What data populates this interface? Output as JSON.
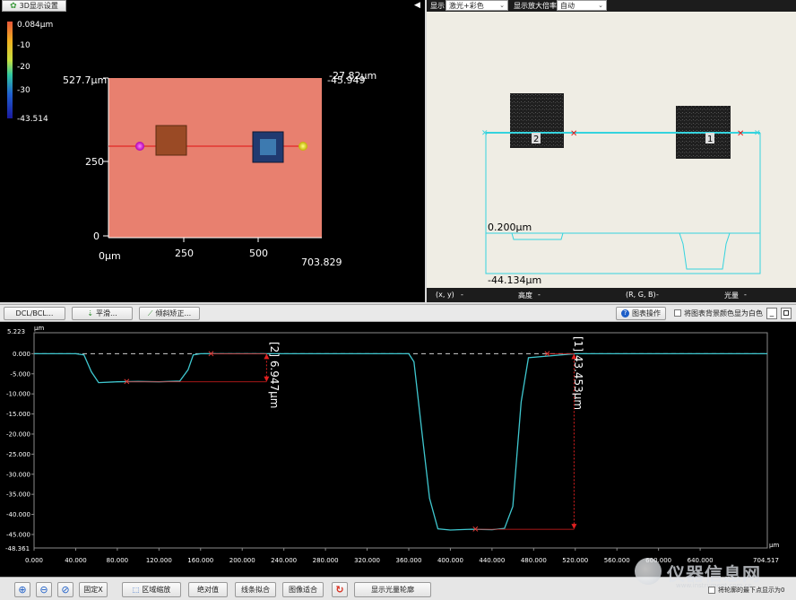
{
  "left_panel": {
    "tab_label": "3D显示设置",
    "colorbar_ticks": [
      "0.084µm",
      "-10",
      "-20",
      "-30",
      "-43.514"
    ],
    "y_top_label": "527.7µm",
    "right_label": "-27.82µm",
    "overlap_label": "-45.949",
    "y_tick_250": "250",
    "y_tick_0": "0",
    "x_ticks": [
      "0µm",
      "250",
      "500"
    ],
    "x_end_label": "703.829"
  },
  "right_panel": {
    "display_label": "显示",
    "display_mode": "激光+彩色",
    "zoom_label": "显示放大倍率",
    "zoom_value": "自动",
    "marker_2": "2",
    "marker_1": "1",
    "profile_top_value": "0.200µm",
    "profile_bottom_value": "-44.134µm",
    "status": {
      "xy": "(x, y)",
      "height": "高度",
      "rgb": "(R, G, B)",
      "light": "光量",
      "dash": "-"
    }
  },
  "toolbar": {
    "dcl_button": "DCL/BCL...",
    "smooth_button": "平滑...",
    "tilt_button": "倾斜矫正...",
    "image_ops_button": "图表操作",
    "white_bg_label": "将图表背景颜色显为白色"
  },
  "profile_chart": {
    "unit_y": "µm",
    "unit_x": "µm",
    "top_label": "5.223",
    "bottom_label": "-48.361",
    "end_label": "704.517",
    "dim2_label": "[2] 6.947µm",
    "dim1_label": "[1] 43.453µm"
  },
  "chart_data": {
    "type": "line",
    "series": [
      {
        "x": [
          0,
          40,
          48,
          55,
          62,
          80,
          100,
          120,
          140,
          148,
          153,
          160,
          240,
          320,
          360,
          365,
          372,
          380,
          388,
          400,
          420,
          440,
          452,
          460,
          468,
          475,
          520,
          560,
          600,
          640,
          704.517
        ],
        "y": [
          0,
          0,
          -0.3,
          -4.5,
          -7.2,
          -7.0,
          -6.9,
          -7.0,
          -6.8,
          -4.0,
          -0.3,
          0,
          0,
          0,
          0,
          -2.0,
          -18.0,
          -36.0,
          -43.6,
          -43.9,
          -43.7,
          -43.8,
          -43.5,
          -38.0,
          -12.0,
          -1.0,
          0,
          0,
          0,
          0,
          0
        ]
      }
    ],
    "xlabel": "µm",
    "ylabel": "µm",
    "xlim": [
      0,
      704.517
    ],
    "ylim": [
      -48.361,
      5.223
    ],
    "x_ticks": [
      "0.000",
      "40.000",
      "80.000",
      "120.000",
      "160.000",
      "200.000",
      "240.000",
      "280.000",
      "320.000",
      "360.000",
      "400.000",
      "440.000",
      "480.000",
      "520.000",
      "560.000",
      "600.000",
      "640.000"
    ],
    "x_tick_values": [
      0,
      40,
      80,
      120,
      160,
      200,
      240,
      280,
      320,
      360,
      400,
      440,
      480,
      520,
      560,
      600,
      640
    ],
    "y_ticks": [
      "0.000",
      "-5.000",
      "-10.000",
      "-15.000",
      "-20.000",
      "-25.000",
      "-30.000",
      "-35.000",
      "-40.000",
      "-45.000"
    ],
    "y_tick_values": [
      0,
      -5,
      -10,
      -15,
      -20,
      -25,
      -30,
      -35,
      -40,
      -45
    ],
    "markers": [
      {
        "x": 89,
        "y": -7.0
      },
      {
        "x": 170,
        "y": 0
      },
      {
        "x": 424,
        "y": -43.7
      },
      {
        "x": 493,
        "y": 0
      }
    ],
    "dimensions": [
      {
        "name": "[2]",
        "value": 6.947,
        "unit": "µm"
      },
      {
        "name": "[1]",
        "value": 43.453,
        "unit": "µm"
      }
    ],
    "grid": false,
    "line_color": "#3fc7cf",
    "marker_color": "#e53935",
    "dimension_color": "#e02020"
  },
  "bottom_bar": {
    "fix_x_button": "固定X",
    "zoom_region_button": "区域缩放",
    "absolute_button": "绝对值",
    "line_fit_button": "线条拟合",
    "image_fit_button": "图像适合",
    "show_profile_button": "显示光量轮廓",
    "bottom_checkbox_label": "将轮廓的最下点显示为0"
  },
  "watermark": "仪器信息网",
  "watermark_sub": "www.instrument.com.cn"
}
